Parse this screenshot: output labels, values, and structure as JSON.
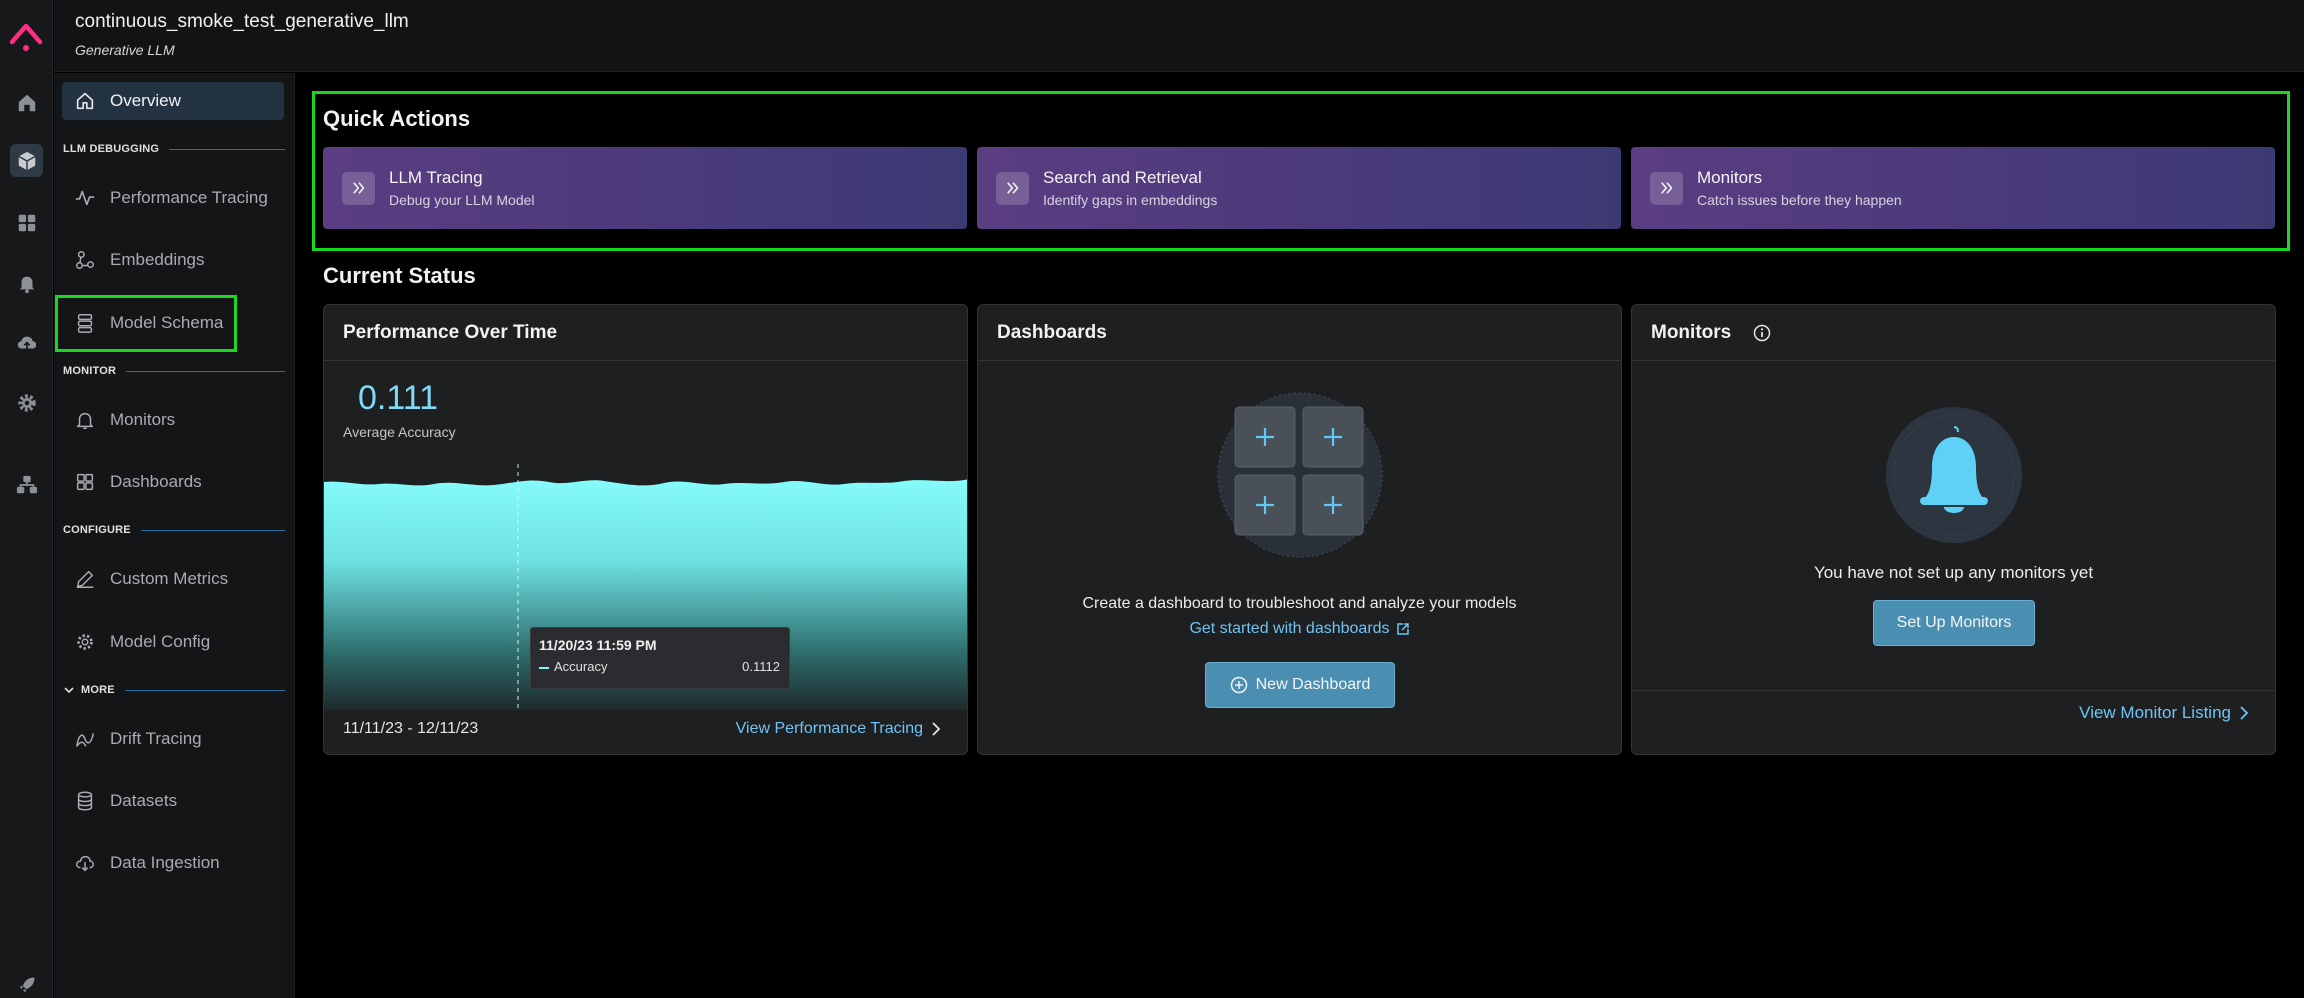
{
  "header": {
    "title": "continuous_smoke_test_generative_llm",
    "subtitle": "Generative LLM"
  },
  "rail": {
    "icons": [
      "arize-logo-icon",
      "home-icon",
      "models-cube-icon",
      "grid-icon",
      "bell-icon",
      "cloud-upload-icon",
      "settings-icon",
      "integrations-icon",
      "rocket-icon"
    ]
  },
  "sidenav": {
    "overview": "Overview",
    "sections": {
      "llm_debugging": "LLM DEBUGGING",
      "monitor": "MONITOR",
      "configure": "CONFIGURE",
      "more": "MORE"
    },
    "items": {
      "performance_tracing": "Performance Tracing",
      "embeddings": "Embeddings",
      "model_schema": "Model Schema",
      "monitors": "Monitors",
      "dashboards": "Dashboards",
      "custom_metrics": "Custom Metrics",
      "model_config": "Model Config",
      "drift_tracing": "Drift Tracing",
      "datasets": "Datasets",
      "data_ingestion": "Data Ingestion"
    }
  },
  "quick_actions": {
    "title": "Quick Actions",
    "cards": [
      {
        "title": "LLM Tracing",
        "desc": "Debug your LLM Model"
      },
      {
        "title": "Search and Retrieval",
        "desc": "Identify gaps in embeddings"
      },
      {
        "title": "Monitors",
        "desc": "Catch issues before they happen"
      }
    ]
  },
  "current_status": {
    "title": "Current Status",
    "performance": {
      "title": "Performance Over Time",
      "value": "0.111",
      "value_label": "Average Accuracy",
      "tooltip_date": "11/20/23 11:59 PM",
      "tooltip_metric": "Accuracy",
      "tooltip_value": "0.1112",
      "date_range": "11/11/23 - 12/11/23",
      "link": "View Performance Tracing"
    },
    "dashboards": {
      "title": "Dashboards",
      "message": "Create a dashboard to troubleshoot and analyze your models",
      "link": "Get started with dashboards",
      "button": "New Dashboard"
    },
    "monitors": {
      "title": "Monitors",
      "message": "You have not set up any monitors yet",
      "button": "Set Up Monitors",
      "link": "View Monitor Listing"
    }
  },
  "colors": {
    "accent": "#6ec4f4",
    "highlight": "#19d81f",
    "chart_fill": "#7ff3f6",
    "quick_action_gradient_start": "#5b3d82"
  }
}
